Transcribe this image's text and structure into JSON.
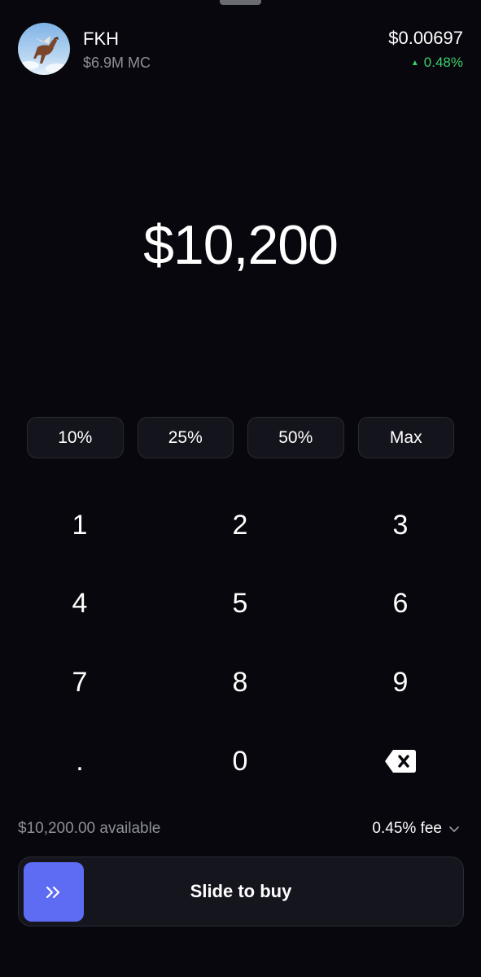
{
  "header": {
    "token_symbol": "FKH",
    "market_cap": "$6.9M MC",
    "price": "$0.00697",
    "change": "0.48%",
    "change_icon": "triangle-up-icon",
    "avatar_icon": "flying-horse-avatar"
  },
  "amount": "$10,200",
  "percent_buttons": [
    "10%",
    "25%",
    "50%",
    "Max"
  ],
  "keypad": {
    "keys": [
      "1",
      "2",
      "3",
      "4",
      "5",
      "6",
      "7",
      "8",
      "9",
      ".",
      "0"
    ],
    "backspace_icon": "backspace-icon"
  },
  "footer": {
    "available": "$10,200.00 available",
    "fee": "0.45% fee",
    "fee_icon": "chevron-down-icon"
  },
  "slider": {
    "label": "Slide to buy",
    "knob_icon": "double-chevron-right-icon"
  },
  "colors": {
    "background": "#07070d",
    "accent": "#5d6cf2",
    "positive": "#3fcf6a",
    "muted_text": "#8f8f98"
  }
}
